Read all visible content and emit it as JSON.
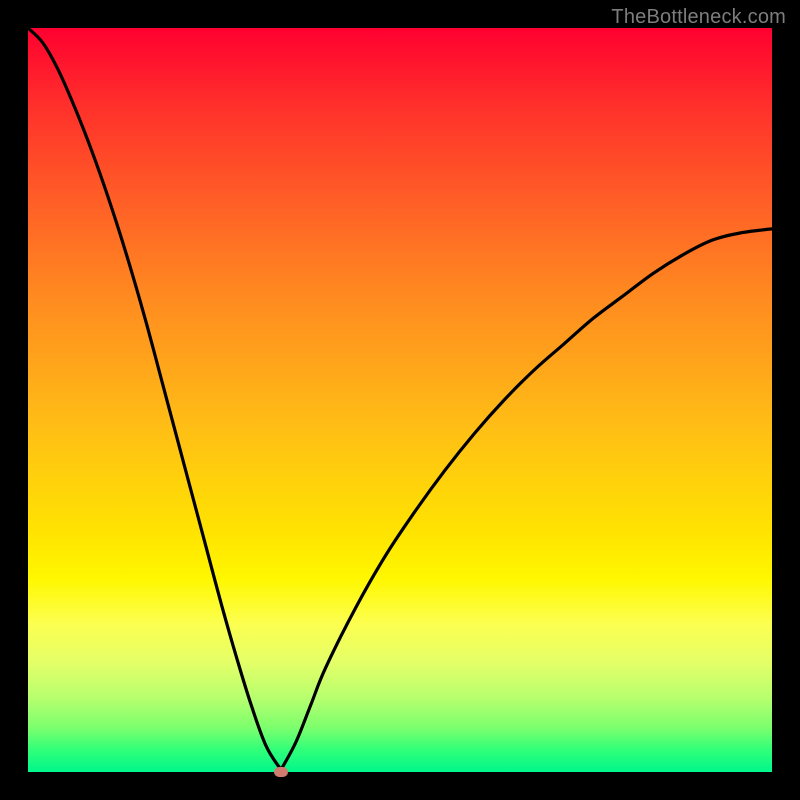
{
  "watermark": "TheBottleneck.com",
  "colors": {
    "frame_bg_top": "#ff0030",
    "frame_bg_bottom": "#00f78b",
    "curve_stroke": "#000000",
    "min_marker": "#cf7b6f",
    "page_bg": "#000000",
    "watermark_text": "#7d7d7d"
  },
  "chart_data": {
    "type": "line",
    "title": "",
    "xlabel": "",
    "ylabel": "",
    "xlim": [
      0,
      100
    ],
    "ylim": [
      0,
      100
    ],
    "grid": false,
    "legend": false,
    "annotations": [],
    "curve_description": "V-shaped bottleneck curve; y≈0 at x≈34, rising steeply to y≈100 as x→0 and gradually to y≈73 as x→100",
    "min_point": {
      "x": 34,
      "y": 0
    },
    "x": [
      0,
      2,
      4,
      6,
      8,
      10,
      12,
      14,
      16,
      18,
      20,
      22,
      24,
      26,
      28,
      30,
      32,
      34,
      36,
      38,
      40,
      44,
      48,
      52,
      56,
      60,
      64,
      68,
      72,
      76,
      80,
      84,
      88,
      92,
      96,
      100
    ],
    "y": [
      100,
      98,
      94.5,
      90,
      85,
      79.5,
      73.5,
      67,
      60,
      52.5,
      45,
      37.5,
      30,
      22.5,
      15.5,
      9,
      3.5,
      0.3,
      4,
      9,
      14,
      22,
      29,
      35,
      40.5,
      45.5,
      50,
      54,
      57.5,
      61,
      64,
      67,
      69.5,
      71.5,
      72.5,
      73
    ]
  }
}
